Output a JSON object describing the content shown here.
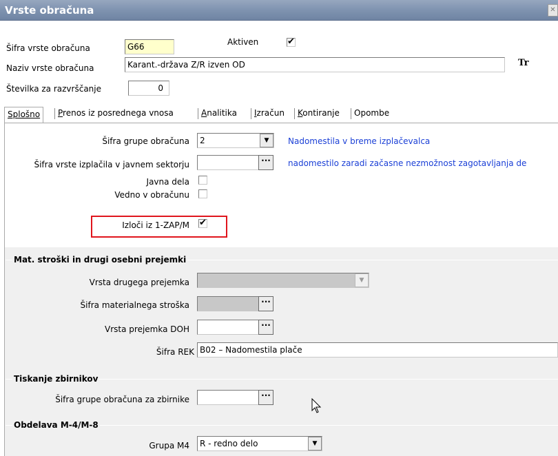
{
  "window": {
    "title": "Vrste obračuna"
  },
  "header": {
    "code_label": "Šifra vrste obračuna",
    "code_value": "G66",
    "active_label": "Aktiven",
    "active_checked": true,
    "name_label": "Naziv vrste obračuna",
    "name_value": "Karant.-država Z/R izven OD",
    "font_icon_text": "Tr",
    "sort_label": "Številka  za razvrščanje",
    "sort_value": "0"
  },
  "tabs": [
    {
      "label": "Splošno",
      "active": true
    },
    {
      "label": "Prenos iz posrednega vnosa",
      "active": false
    },
    {
      "label": "Analitika",
      "active": false
    },
    {
      "label": "Izračun",
      "active": false
    },
    {
      "label": "Kontiranje",
      "active": false
    },
    {
      "label": "Opombe",
      "active": false
    }
  ],
  "general": {
    "group_label": "Šifra grupe obračuna",
    "group_value": "2",
    "group_desc": "Nadomestila v breme izplačevalca",
    "payout_label": "Šifra vrste izplačila v javnem sektorju",
    "payout_value": "",
    "payout_desc": "nadomestilo zaradi začasne nezmožnost zagotavljanja de",
    "public_works_label": "Javna dela",
    "public_works_checked": false,
    "always_label": "Vedno v obračunu",
    "always_checked": false,
    "exclude_label": "Izloči iz 1-ZAP/M",
    "exclude_checked": true
  },
  "mat_costs": {
    "title": "Mat. stroški in drugi osebni prejemki",
    "other_income_label": "Vrsta drugega prejemka",
    "other_income_value": "",
    "material_cost_label": "Šifra materialnega stroška",
    "material_cost_value": "",
    "doh_label": "Vrsta prejemka DOH",
    "doh_value": "",
    "rek_label": "Šifra REK",
    "rek_value": "B02 – Nadomestila plače"
  },
  "printing": {
    "title": "Tiskanje zbirnikov",
    "group_label": "Šifra grupe obračuna za zbirnike",
    "group_value": ""
  },
  "m4": {
    "title": "Obdelava M-4/M-8",
    "group_label": "Grupa M4",
    "group_value": "R - redno delo"
  },
  "glyphs": {
    "check": "✔",
    "ellipsis": "···",
    "dropdown": "▼",
    "corner": "✕"
  },
  "colors": {
    "titlebar": "#7f93b0",
    "link_blue": "#1a3fd6",
    "highlight_red": "#e0141c",
    "required_yellow": "#ffffcc"
  }
}
